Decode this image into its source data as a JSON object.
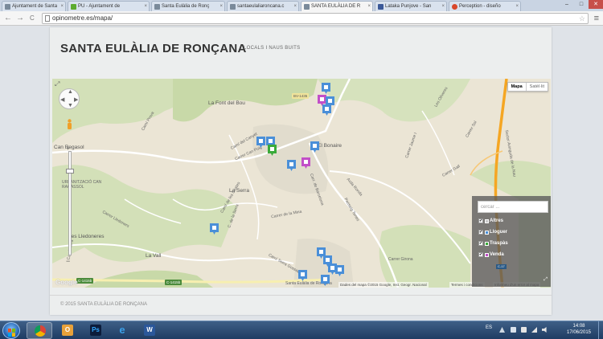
{
  "browser": {
    "tabs": [
      {
        "label": "Ajuntament de Santa",
        "fav": "#7a8a9a"
      },
      {
        "label": "PU - Ajuntament de",
        "fav": "#5dab2f"
      },
      {
        "label": "Santa Eulàlia de Ronç",
        "fav": "#7a8a9a"
      },
      {
        "label": "santaeulaliaroncana.c",
        "fav": "#7a8a9a"
      },
      {
        "label": "SANTA EULÀLIA DE R",
        "fav": "#7a8a9a"
      },
      {
        "label": "Lataka Punjove - San",
        "fav": "#3b5998"
      },
      {
        "label": "Perception - diseño",
        "fav": "#d9472b"
      }
    ],
    "tab_close": "×",
    "url": "opinometre.es/mapa/",
    "star": "☆",
    "menu": "≡",
    "back": "←",
    "forward": "→",
    "reload": "C",
    "window": {
      "minimize": "–",
      "maximize": "□",
      "close": "✕"
    }
  },
  "site": {
    "title": "SANTA EULÀLIA DE RONÇANA",
    "subtitle": "LOCALS I NAUS BUITS",
    "footer": "© 2015 SANTA EULÀLIA DE RONÇANA"
  },
  "map": {
    "type_buttons": {
      "map": "Mapa",
      "satellite": "Satèl·lit"
    },
    "labels": {
      "font_del_bou": "La Font del Bou",
      "el_bonaire": "El Bonaire",
      "can_regasol": "Can Regasol",
      "urbanitzacio": "URBANITZACIÓ CAN RAGASSOL",
      "la_serra": "La Serra",
      "les_lledoneres": "Les Lledoneres",
      "la_vall": "La Vall",
      "town": "Santa Eulàlia de Ronçana",
      "bv1435": "BV-1435",
      "c1415b": "C-1415b",
      "c1415b2": "C-1415b",
      "carrer_girona": "Carrer Girona",
      "carrer_barcelona": "Carr. de Barcelona",
      "camino_prova": "Camí Prova",
      "carrer_can_puig": "Carrer Can Puig",
      "avda_ronda": "Avda Ronda",
      "carrer_jaume": "Carrer Jaume I",
      "sector_avinguda": "Sector Avinguda de la Nau",
      "carrer_sol": "Carrer Sol",
      "les_oliveres": "Les Oliveres",
      "carrer_gall": "Carrer Gall",
      "camí_del_canyet": "Camí del Canyet",
      "cami_costes": "Camí de les Costes",
      "cami_riera": "Camí Riera",
      "carrer_lledoners": "Carrer Lledoners",
      "cami_serra": "Camí Serra Gossada",
      "carrer_la_mina": "Carrer de la Mina",
      "c_de_la_serra": "C. de la Serra",
      "passeig": "Passeig Tenes"
    },
    "google": "Google",
    "attribution": "Dades del mapa ©2015 Google, Inst. Geogr. Nacional",
    "terms": "Termes i condicions",
    "report": "Informeu d'un error al mapa"
  },
  "filter": {
    "search_placeholder": "cercar ...",
    "items": [
      {
        "label": "Altres",
        "color": "#c8c8c8"
      },
      {
        "label": "Lloguer",
        "color": "#4a8fd8"
      },
      {
        "label": "Traspàs",
        "color": "#3aaa3a"
      },
      {
        "label": "Venda",
        "color": "#c24fc8"
      }
    ],
    "check": "✔",
    "resize": "⤢",
    "road_badge": "C-17"
  },
  "taskbar": {
    "language": "ES",
    "time": "14:08",
    "date": "17/06/2015",
    "apps": [
      {
        "name": "chrome",
        "active": true
      },
      {
        "name": "outlook",
        "active": false
      },
      {
        "name": "photoshop",
        "active": false
      },
      {
        "name": "internet-explorer",
        "active": false
      },
      {
        "name": "word",
        "active": false
      }
    ]
  },
  "colors": {
    "blue_marker": "#4a8fd8",
    "purple_marker": "#c24fc8",
    "green_marker": "#3aaa3a",
    "highway": "#f5a623"
  }
}
